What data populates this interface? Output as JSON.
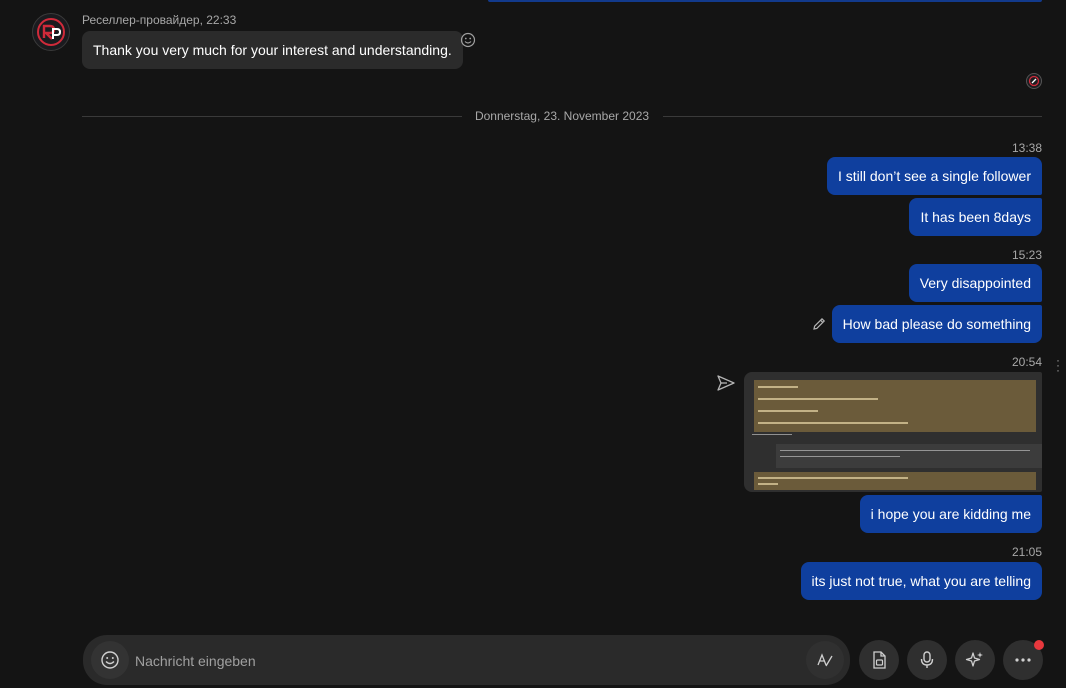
{
  "received": {
    "sender_meta": "Реселлер-провайдер, 22:33",
    "text": "Thank you very much for your interest and understanding."
  },
  "date_divider": "Donnerstag, 23. November 2023",
  "groups": [
    {
      "time": "13:38",
      "messages": [
        "I still don’t see a single follower",
        "It has been 8days"
      ]
    },
    {
      "time": "15:23",
      "messages": [
        "Very disappointed",
        "How bad please do something"
      ]
    },
    {
      "time": "20:54",
      "messages": [
        "i hope you are kidding me"
      ]
    },
    {
      "time": "21:05",
      "messages": [
        "its just not true, what you are telling"
      ]
    }
  ],
  "composer": {
    "placeholder": "Nachricht eingeben"
  },
  "icons": {
    "emoji": "smiley-icon",
    "react": "add-reaction-icon",
    "edit": "pencil-icon",
    "forward": "send-forward-icon",
    "format": "text-format-icon",
    "attach": "attach-file-icon",
    "mic": "microphone-icon",
    "ai": "sparkle-icon",
    "more": "more-horizontal-icon"
  },
  "colors": {
    "sent_bubble": "#0f3f9e",
    "received_bubble": "#2b2b2b",
    "notification_dot": "#e8383d"
  }
}
